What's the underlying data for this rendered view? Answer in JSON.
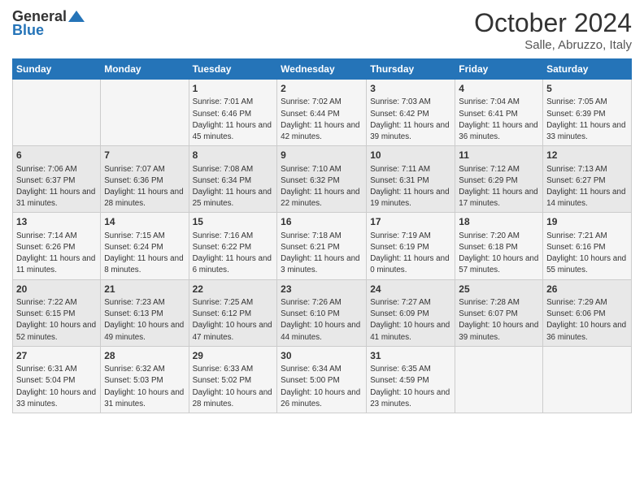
{
  "header": {
    "logo_general": "General",
    "logo_blue": "Blue",
    "month_title": "October 2024",
    "subtitle": "Salle, Abruzzo, Italy"
  },
  "days_of_week": [
    "Sunday",
    "Monday",
    "Tuesday",
    "Wednesday",
    "Thursday",
    "Friday",
    "Saturday"
  ],
  "weeks": [
    [
      {
        "day": "",
        "text": ""
      },
      {
        "day": "",
        "text": ""
      },
      {
        "day": "1",
        "text": "Sunrise: 7:01 AM\nSunset: 6:46 PM\nDaylight: 11 hours and 45 minutes."
      },
      {
        "day": "2",
        "text": "Sunrise: 7:02 AM\nSunset: 6:44 PM\nDaylight: 11 hours and 42 minutes."
      },
      {
        "day": "3",
        "text": "Sunrise: 7:03 AM\nSunset: 6:42 PM\nDaylight: 11 hours and 39 minutes."
      },
      {
        "day": "4",
        "text": "Sunrise: 7:04 AM\nSunset: 6:41 PM\nDaylight: 11 hours and 36 minutes."
      },
      {
        "day": "5",
        "text": "Sunrise: 7:05 AM\nSunset: 6:39 PM\nDaylight: 11 hours and 33 minutes."
      }
    ],
    [
      {
        "day": "6",
        "text": "Sunrise: 7:06 AM\nSunset: 6:37 PM\nDaylight: 11 hours and 31 minutes."
      },
      {
        "day": "7",
        "text": "Sunrise: 7:07 AM\nSunset: 6:36 PM\nDaylight: 11 hours and 28 minutes."
      },
      {
        "day": "8",
        "text": "Sunrise: 7:08 AM\nSunset: 6:34 PM\nDaylight: 11 hours and 25 minutes."
      },
      {
        "day": "9",
        "text": "Sunrise: 7:10 AM\nSunset: 6:32 PM\nDaylight: 11 hours and 22 minutes."
      },
      {
        "day": "10",
        "text": "Sunrise: 7:11 AM\nSunset: 6:31 PM\nDaylight: 11 hours and 19 minutes."
      },
      {
        "day": "11",
        "text": "Sunrise: 7:12 AM\nSunset: 6:29 PM\nDaylight: 11 hours and 17 minutes."
      },
      {
        "day": "12",
        "text": "Sunrise: 7:13 AM\nSunset: 6:27 PM\nDaylight: 11 hours and 14 minutes."
      }
    ],
    [
      {
        "day": "13",
        "text": "Sunrise: 7:14 AM\nSunset: 6:26 PM\nDaylight: 11 hours and 11 minutes."
      },
      {
        "day": "14",
        "text": "Sunrise: 7:15 AM\nSunset: 6:24 PM\nDaylight: 11 hours and 8 minutes."
      },
      {
        "day": "15",
        "text": "Sunrise: 7:16 AM\nSunset: 6:22 PM\nDaylight: 11 hours and 6 minutes."
      },
      {
        "day": "16",
        "text": "Sunrise: 7:18 AM\nSunset: 6:21 PM\nDaylight: 11 hours and 3 minutes."
      },
      {
        "day": "17",
        "text": "Sunrise: 7:19 AM\nSunset: 6:19 PM\nDaylight: 11 hours and 0 minutes."
      },
      {
        "day": "18",
        "text": "Sunrise: 7:20 AM\nSunset: 6:18 PM\nDaylight: 10 hours and 57 minutes."
      },
      {
        "day": "19",
        "text": "Sunrise: 7:21 AM\nSunset: 6:16 PM\nDaylight: 10 hours and 55 minutes."
      }
    ],
    [
      {
        "day": "20",
        "text": "Sunrise: 7:22 AM\nSunset: 6:15 PM\nDaylight: 10 hours and 52 minutes."
      },
      {
        "day": "21",
        "text": "Sunrise: 7:23 AM\nSunset: 6:13 PM\nDaylight: 10 hours and 49 minutes."
      },
      {
        "day": "22",
        "text": "Sunrise: 7:25 AM\nSunset: 6:12 PM\nDaylight: 10 hours and 47 minutes."
      },
      {
        "day": "23",
        "text": "Sunrise: 7:26 AM\nSunset: 6:10 PM\nDaylight: 10 hours and 44 minutes."
      },
      {
        "day": "24",
        "text": "Sunrise: 7:27 AM\nSunset: 6:09 PM\nDaylight: 10 hours and 41 minutes."
      },
      {
        "day": "25",
        "text": "Sunrise: 7:28 AM\nSunset: 6:07 PM\nDaylight: 10 hours and 39 minutes."
      },
      {
        "day": "26",
        "text": "Sunrise: 7:29 AM\nSunset: 6:06 PM\nDaylight: 10 hours and 36 minutes."
      }
    ],
    [
      {
        "day": "27",
        "text": "Sunrise: 6:31 AM\nSunset: 5:04 PM\nDaylight: 10 hours and 33 minutes."
      },
      {
        "day": "28",
        "text": "Sunrise: 6:32 AM\nSunset: 5:03 PM\nDaylight: 10 hours and 31 minutes."
      },
      {
        "day": "29",
        "text": "Sunrise: 6:33 AM\nSunset: 5:02 PM\nDaylight: 10 hours and 28 minutes."
      },
      {
        "day": "30",
        "text": "Sunrise: 6:34 AM\nSunset: 5:00 PM\nDaylight: 10 hours and 26 minutes."
      },
      {
        "day": "31",
        "text": "Sunrise: 6:35 AM\nSunset: 4:59 PM\nDaylight: 10 hours and 23 minutes."
      },
      {
        "day": "",
        "text": ""
      },
      {
        "day": "",
        "text": ""
      }
    ]
  ]
}
